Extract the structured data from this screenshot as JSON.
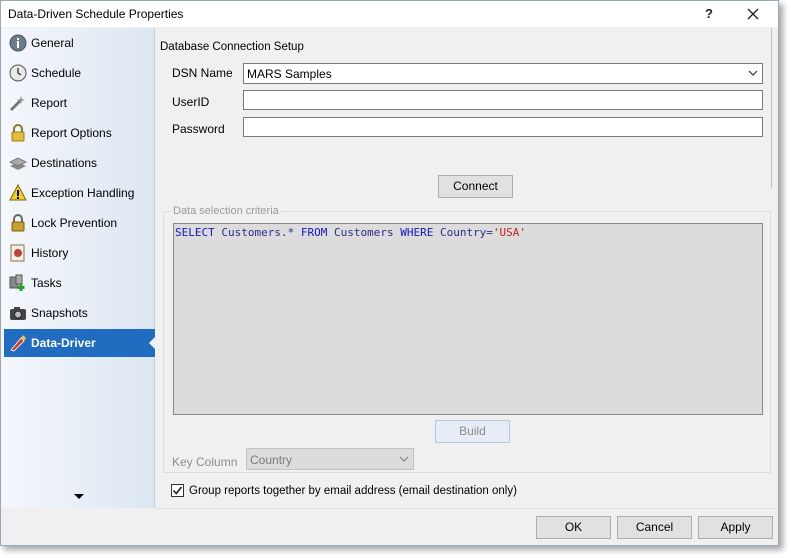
{
  "window": {
    "title": "Data-Driven Schedule Properties",
    "help_label": "?"
  },
  "sidebar": {
    "items": [
      {
        "label": "General",
        "icon": "info-icon"
      },
      {
        "label": "Schedule",
        "icon": "clock-icon"
      },
      {
        "label": "Report",
        "icon": "wand-icon"
      },
      {
        "label": "Report Options",
        "icon": "lock-icon"
      },
      {
        "label": "Destinations",
        "icon": "stack-icon"
      },
      {
        "label": "Exception Handling",
        "icon": "warning-icon"
      },
      {
        "label": "Lock Prevention",
        "icon": "padlock-icon"
      },
      {
        "label": "History",
        "icon": "history-icon"
      },
      {
        "label": "Tasks",
        "icon": "tasks-icon"
      },
      {
        "label": "Snapshots",
        "icon": "camera-icon"
      },
      {
        "label": "Data-Driver",
        "icon": "data-driver-icon",
        "active": true
      }
    ]
  },
  "db": {
    "group_title": "Database Connection Setup",
    "dsn_label": "DSN Name",
    "dsn_value": "MARS Samples",
    "userid_label": "UserID",
    "userid_value": "",
    "password_label": "Password",
    "password_value": "",
    "connect_label": "Connect"
  },
  "criteria": {
    "legend": "Data selection criteria",
    "sql": {
      "kw1": "SELECT",
      "t1": " Customers.* ",
      "kw2": "FROM",
      "t2": " Customers ",
      "kw3": "WHERE",
      "t3": " Country=",
      "str": "'USA'"
    },
    "build_label": "Build",
    "key_column_label": "Key Column",
    "key_column_value": "Country"
  },
  "options": {
    "group_label": "Group reports together by email address (email destination only)",
    "group_checked": true
  },
  "footer": {
    "ok_label": "OK",
    "cancel_label": "Cancel",
    "apply_label": "Apply"
  },
  "colors": {
    "active_nav": "#1f6cc0",
    "sql_keyword": "#1515c8",
    "sql_string": "#c62020"
  }
}
